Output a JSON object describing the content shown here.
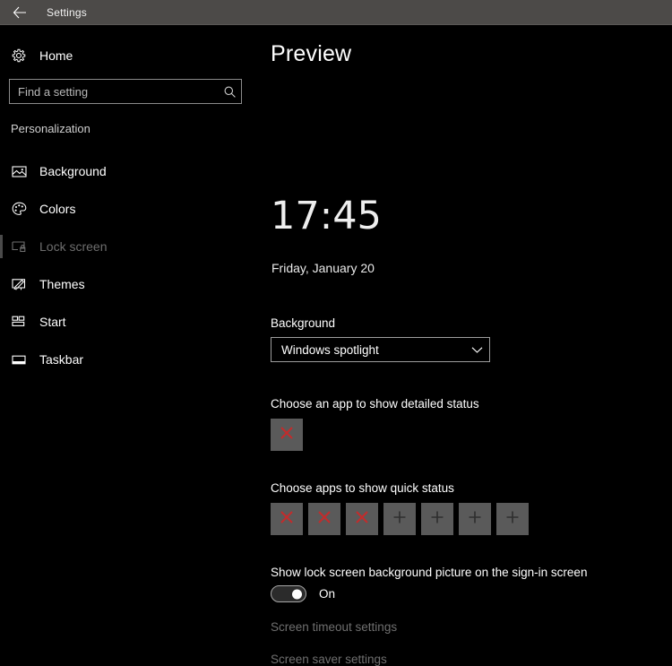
{
  "titlebar": {
    "back_icon": "back-arrow-icon",
    "title": "Settings"
  },
  "sidebar": {
    "home": {
      "icon": "gear-icon",
      "label": "Home"
    },
    "search": {
      "placeholder": "Find a setting",
      "value": "",
      "icon": "search-icon"
    },
    "section_header": "Personalization",
    "items": [
      {
        "label": "Background",
        "icon": "picture-icon",
        "selected": false
      },
      {
        "label": "Colors",
        "icon": "palette-icon",
        "selected": false
      },
      {
        "label": "Lock screen",
        "icon": "monitor-lock-icon",
        "selected": true
      },
      {
        "label": "Themes",
        "icon": "brush-canvas-icon",
        "selected": false
      },
      {
        "label": "Start",
        "icon": "tile-grid-icon",
        "selected": false
      },
      {
        "label": "Taskbar",
        "icon": "taskbar-icon",
        "selected": false
      }
    ]
  },
  "main": {
    "page_title": "Preview",
    "preview": {
      "time": "17:45",
      "date": "Friday, January 20"
    },
    "background": {
      "label": "Background",
      "selected_option": "Windows spotlight",
      "chevron_icon": "chevron-down-icon"
    },
    "detailed_status": {
      "label": "Choose an app to show detailed status",
      "tile": {
        "icon": "red-x-icon"
      }
    },
    "quick_status": {
      "label": "Choose apps to show quick status",
      "tiles": [
        {
          "icon": "red-x-icon"
        },
        {
          "icon": "red-x-icon"
        },
        {
          "icon": "red-x-icon"
        },
        {
          "icon": "plus-icon"
        },
        {
          "icon": "plus-icon"
        },
        {
          "icon": "plus-icon"
        },
        {
          "icon": "plus-icon"
        }
      ]
    },
    "signin": {
      "label": "Show lock screen background picture on the sign-in screen",
      "toggle_state": "On",
      "toggle_on": true
    },
    "links": [
      {
        "label": "Screen timeout settings"
      },
      {
        "label": "Screen saver settings"
      }
    ]
  },
  "colors": {
    "titlebar_bg": "#4c4a48",
    "page_bg": "#000000",
    "tile_bg": "#5a5a5a",
    "error_x": "#c42b2b",
    "disabled_text": "#6f6f6f"
  }
}
